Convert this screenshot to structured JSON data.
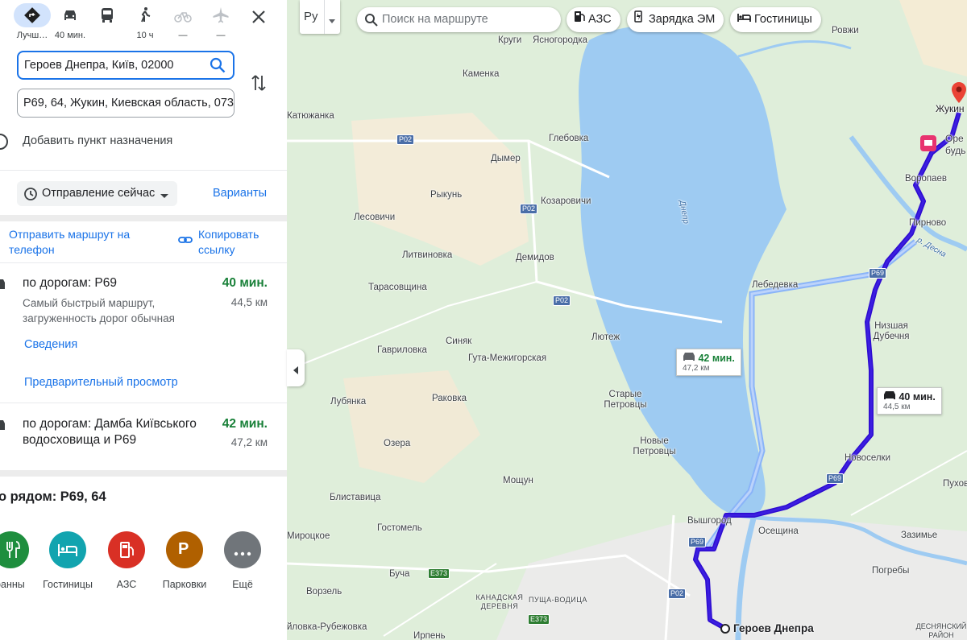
{
  "modes": [
    {
      "icon": "directions-icon",
      "label": "Лучш…"
    },
    {
      "icon": "car-icon",
      "label": "40 мин."
    },
    {
      "icon": "bus-icon",
      "label": ""
    },
    {
      "icon": "walk-icon",
      "label": "10 ч"
    },
    {
      "icon": "bicycle-icon",
      "label": "—"
    },
    {
      "icon": "plane-icon",
      "label": "—"
    }
  ],
  "route": {
    "origin": "Героев Днепра, Київ, 02000",
    "destination": "Р69, 64, Жукин, Киевская область, 073",
    "add_destination": "Добавить пункт назначения"
  },
  "depart": {
    "label": "Отправление сейчас",
    "options": "Варианты"
  },
  "share": {
    "send": "Отправить маршрут на телефон",
    "copy": "Копировать ссылку"
  },
  "routes": [
    {
      "title": "по дорогам: Р69",
      "time": "40 мин.",
      "distance": "44,5 км",
      "desc": "Самый быстрый маршрут, загруженность дорог обычная",
      "details": "Сведения",
      "preview": "Предварительный просмотр"
    },
    {
      "title": "по дорогам: Дамба Київського водосховища и Р69",
      "time": "42 мин.",
      "distance": "47,2 км"
    }
  ],
  "nearby": {
    "title": "о рядом: Р69, 64",
    "items": [
      {
        "label": "сторанны",
        "icon": "restaurant-icon",
        "color": "#1e8e3e"
      },
      {
        "label": "Гостиницы",
        "icon": "hotel-icon",
        "color": "#12a4af"
      },
      {
        "label": "АЗС",
        "icon": "gas-station-icon",
        "color": "#d93025"
      },
      {
        "label": "Парковки",
        "icon": "parking-icon",
        "color": "#b06000"
      },
      {
        "label": "Ещё",
        "icon": "more-icon",
        "color": "#70757a"
      }
    ]
  },
  "map": {
    "layer_button": "Ру",
    "search_placeholder": "Поиск на маршруте",
    "chips": [
      "АЗС",
      "Зарядка ЭМ",
      "Гостиницы"
    ],
    "callout1": {
      "time": "42 мин.",
      "distance": "47,2 км"
    },
    "callout2": {
      "time": "40 мин.",
      "distance": "44,5 км"
    },
    "origin_label": "Героев Днепра",
    "destination_label": "Жукин",
    "places": [
      "Круги",
      "Ясногородка",
      "Ровжи",
      "Каменка",
      "Катюжанка",
      "Глебовка",
      "Дымер",
      "Рыкунь",
      "Козаровичи",
      "Лесовичи",
      "Литвиновка",
      "Демидов",
      "Тарасовщина",
      "Синяк",
      "Гута-Межигорская",
      "Лютеж",
      "Гавриловка",
      "Лубянка",
      "Раковка",
      "Старые Петровцы",
      "Новые Петровцы",
      "Озера",
      "Мощун",
      "Блиставица",
      "Вышгород",
      "Осещина",
      "Гостомель",
      "Мироцкое",
      "Буча",
      "Ворзель",
      "Ирпень",
      "йловка-Рубежовка",
      "КАНАДСКАЯ ДЕРЕВНЯ",
      "ПУЩА-ВОДИЦА",
      "ДЕСНЯНСКИЙ РАЙОН",
      "Лебедевка",
      "Низшая Дубечня",
      "Новоселки",
      "Воропаев",
      "Пирново",
      "Зазимье",
      "Погребы",
      "Пухов",
      "Оре будь",
      "Днепр",
      "р. Десна"
    ],
    "roads": [
      "Р02",
      "Р02",
      "Р02",
      "Р69",
      "Р69",
      "Р69",
      "Е373",
      "Е373",
      "Р02"
    ]
  }
}
